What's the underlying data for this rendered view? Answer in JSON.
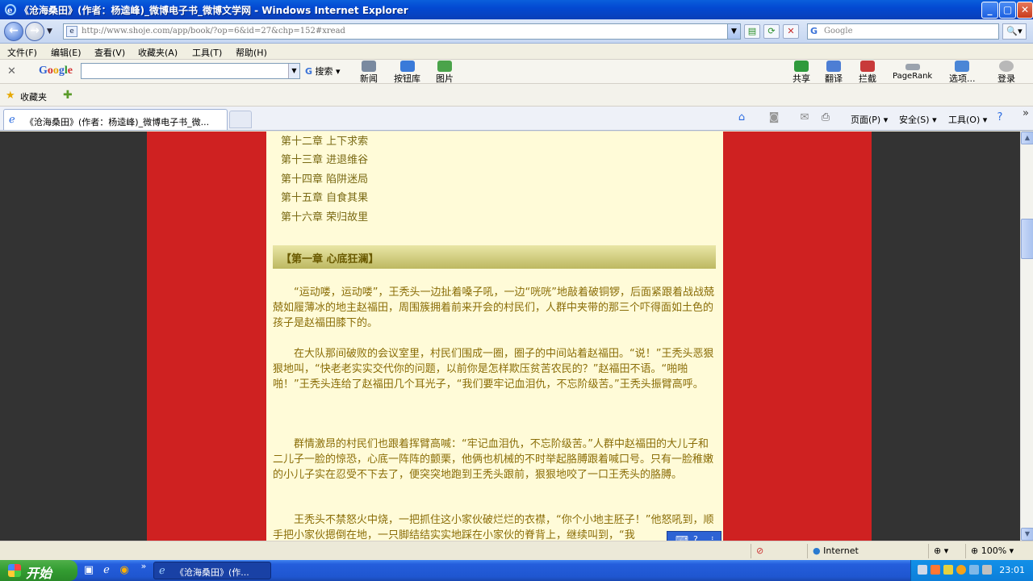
{
  "window": {
    "title": "《沧海桑田》(作者：杨逵峰)_微博电子书_微博文学网 - Windows Internet Explorer"
  },
  "address": {
    "url": "http://www.shoje.com/app/book/?op=6&id=27&chp=152#xread",
    "search_placeholder": "Google"
  },
  "menu": [
    "文件(F)",
    "编辑(E)",
    "查看(V)",
    "收藏夹(A)",
    "工具(T)",
    "帮助(H)"
  ],
  "google_toolbar": {
    "logo": "Google",
    "search_label": "搜索",
    "buttons": [
      "新闻",
      "按钮库",
      "图片",
      "共享",
      "翻译",
      "拦截",
      "PageRank",
      "选项...",
      "登录"
    ]
  },
  "favorites": {
    "label": "收藏夹"
  },
  "tabs": [
    {
      "label": "《沧海桑田》(作者：杨逵峰)_微博电子书_微..."
    }
  ],
  "commandbar": {
    "page": "页面(P)",
    "safety": "安全(S)",
    "tools": "工具(O)"
  },
  "toc": [
    "第十二章  上下求索",
    "第十三章  进退维谷",
    "第十四章  陷阱迷局",
    "第十五章  自食其果",
    "第十六章  荣归故里"
  ],
  "chapter_heading": "【第一章  心底狂澜】",
  "paragraphs": [
    "“运动喽，运动喽”，王秃头一边扯着嗓子吼，一边“咣咣”地敲着破铜锣，后面紧跟着战战兢兢如履薄冰的地主赵福田，周围簇拥着前来开会的村民们，人群中夹带的那三个吓得面如土色的孩子是赵福田膝下的。",
    "在大队那间破败的会议室里，村民们围成一圈，圈子的中间站着赵福田。“说！”王秃头恶狠狠地叫，“快老老实实交代你的问题，以前你是怎样欺压贫苦农民的？”赵福田不语。“啪啪啪！”王秃头连给了赵福田几个耳光子，“我们要牢记血泪仇，不忘阶级苦。”王秃头振臂高呼。",
    "群情激昂的村民们也跟着挥臂高喊：“牢记血泪仇，不忘阶级苦。”人群中赵福田的大儿子和二儿子一脸的惊恐，心底一阵阵的颤栗，他俩也机械的不时举起胳膊跟着喊口号。只有一脸稚嫩的小儿子实在忍受不下去了，便突突地跑到王秃头跟前，狠狠地咬了一口王秃头的胳膊。",
    "王秃头不禁怒火中烧，一把抓住这小家伙破烂烂的衣襟，“你个小地主胚子！”他怒吼到，顺手把小家伙摁倒在地，一只脚结结实实地踩在小家伙的脊背上，继续叫到，“我"
  ],
  "status": {
    "zone": "Internet",
    "zoom": "100%"
  },
  "taskbar": {
    "start": "开始",
    "task": "《沧海桑田》(作...",
    "clock": "23:01"
  }
}
